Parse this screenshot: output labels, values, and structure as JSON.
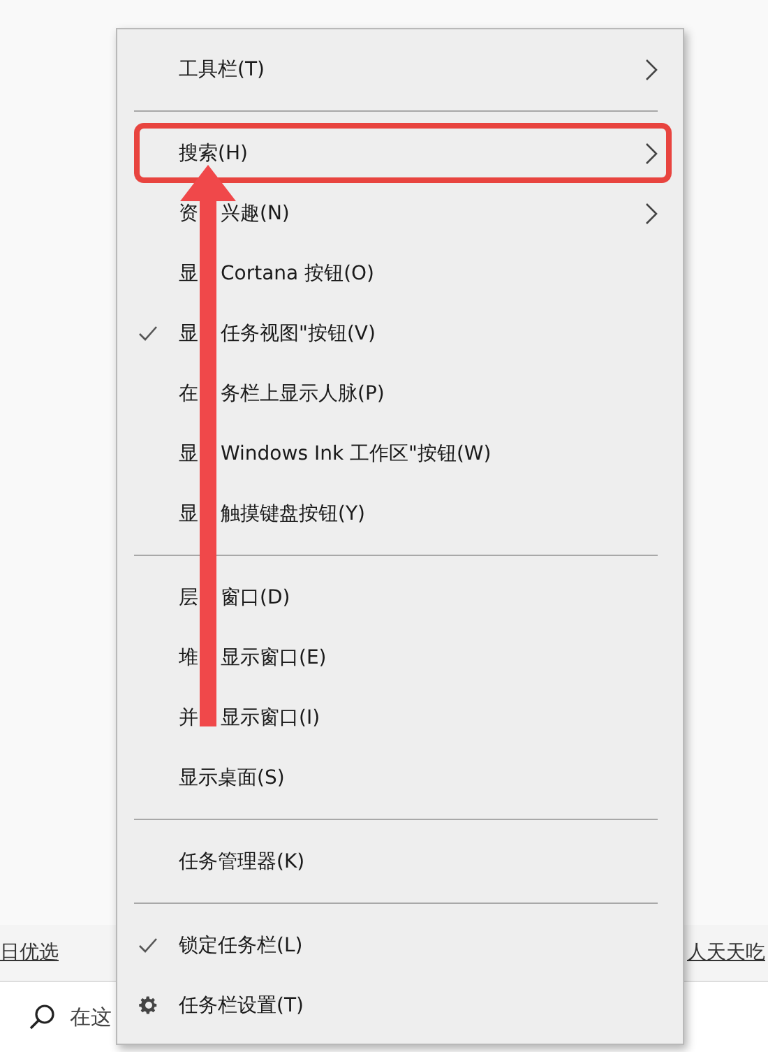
{
  "background": {
    "left_link": "日优选",
    "right_link": "人天天吃",
    "search": {
      "placeholder": "在这"
    }
  },
  "menu": {
    "items": [
      {
        "kind": "item",
        "label": "工具栏(T)",
        "checked": false,
        "submenu": true,
        "highlighted": false
      },
      {
        "kind": "separator"
      },
      {
        "kind": "item",
        "label": "搜索(H)",
        "checked": false,
        "submenu": true,
        "highlighted": true
      },
      {
        "kind": "item",
        "parts": [
          "资",
          "兴趣(N)"
        ],
        "checked": false,
        "submenu": true,
        "highlighted": false
      },
      {
        "kind": "item",
        "parts": [
          "显",
          "Cortana 按钮(O)"
        ],
        "checked": false,
        "submenu": false,
        "highlighted": false
      },
      {
        "kind": "item",
        "parts": [
          "显",
          "任务视图\"按钮(V)"
        ],
        "checked": true,
        "submenu": false,
        "highlighted": false
      },
      {
        "kind": "item",
        "parts": [
          "在",
          "务栏上显示人脉(P)"
        ],
        "checked": false,
        "submenu": false,
        "highlighted": false
      },
      {
        "kind": "item",
        "parts": [
          "显",
          "Windows Ink 工作区\"按钮(W)"
        ],
        "checked": false,
        "submenu": false,
        "highlighted": false
      },
      {
        "kind": "item",
        "parts": [
          "显",
          "触摸键盘按钮(Y)"
        ],
        "checked": false,
        "submenu": false,
        "highlighted": false
      },
      {
        "kind": "separator"
      },
      {
        "kind": "item",
        "parts": [
          "层",
          "窗口(D)"
        ],
        "checked": false,
        "submenu": false,
        "highlighted": false
      },
      {
        "kind": "item",
        "parts": [
          "堆",
          "显示窗口(E)"
        ],
        "checked": false,
        "submenu": false,
        "highlighted": false
      },
      {
        "kind": "item",
        "parts": [
          "并",
          "显示窗口(I)"
        ],
        "checked": false,
        "submenu": false,
        "highlighted": false
      },
      {
        "kind": "item",
        "label": "显示桌面(S)",
        "checked": false,
        "submenu": false,
        "highlighted": false
      },
      {
        "kind": "separator"
      },
      {
        "kind": "item",
        "label": "任务管理器(K)",
        "checked": false,
        "submenu": false,
        "highlighted": false
      },
      {
        "kind": "separator"
      },
      {
        "kind": "item",
        "label": "锁定任务栏(L)",
        "checked": true,
        "submenu": false,
        "highlighted": false
      },
      {
        "kind": "settings",
        "label": "任务栏设置(T)",
        "submenu": false,
        "highlighted": false
      }
    ]
  }
}
